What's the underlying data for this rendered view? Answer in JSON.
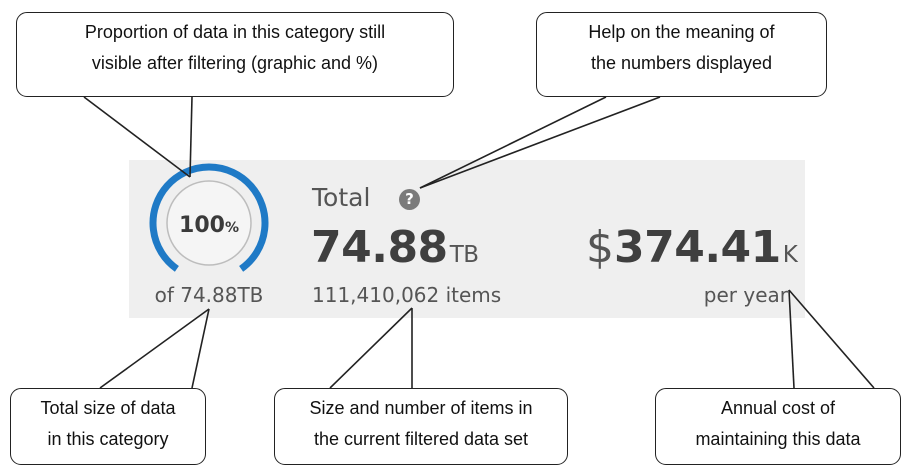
{
  "summary": {
    "gauge": {
      "percent": "100",
      "percent_symbol": "%",
      "fill_fraction": 1.0,
      "color": "#1f7ac6"
    },
    "gauge_caption": "of 74.88TB",
    "total_label": "Total",
    "help_icon": "question-circle-icon",
    "size_value": "74.88",
    "size_unit": "TB",
    "items_count": "111,410,062 items",
    "cost_currency": "$",
    "cost_value": "374.41",
    "cost_unit": "K",
    "cost_period": "per year"
  },
  "callouts": {
    "gauge_proportion": [
      "Proportion of data in this category still",
      "visible after filtering (graphic and %)"
    ],
    "help": [
      "Help on the meaning of",
      "the numbers displayed"
    ],
    "category_size": [
      "Total size of data",
      "in this category"
    ],
    "filtered_size": [
      "Size and number of items in",
      "the current filtered data set"
    ],
    "annual_cost": [
      "Annual cost of",
      "maintaining this data"
    ]
  }
}
